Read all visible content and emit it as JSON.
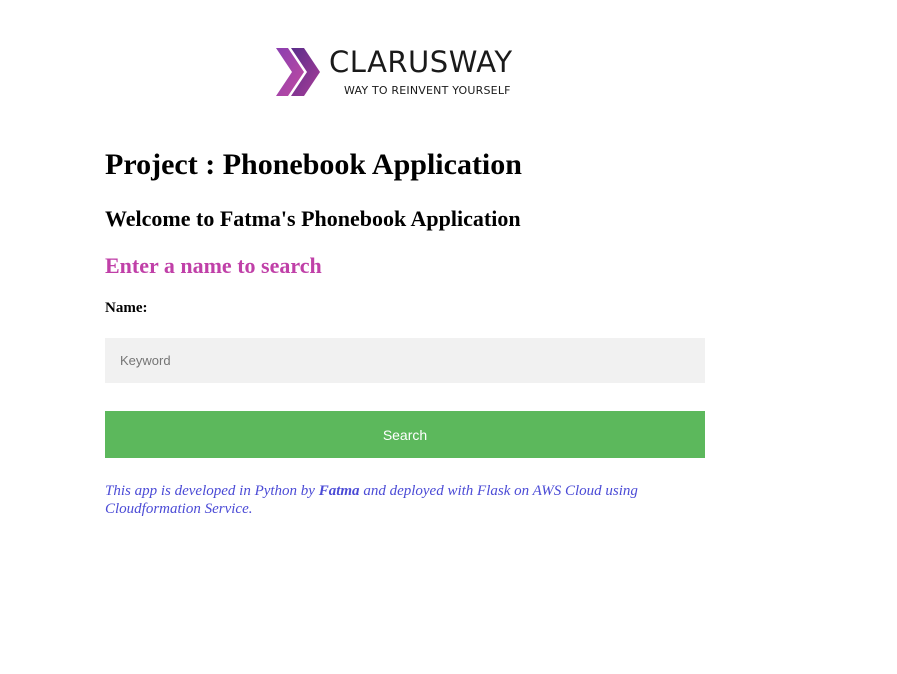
{
  "logo": {
    "wordmark": "CLARUSWAY",
    "tagline": "WAY TO REINVENT YOURSELF"
  },
  "header": {
    "title": "Project : Phonebook Application",
    "welcome": "Welcome to Fatma's Phonebook Application"
  },
  "search": {
    "heading": "Enter a name to search",
    "label": "Name:",
    "placeholder": "Keyword",
    "value": "",
    "button_label": "Search"
  },
  "footer": {
    "text_before": "This app is developed in Python by ",
    "author": "Fatma",
    "text_after": " and deployed with Flask on AWS Cloud using Cloudformation Service."
  },
  "colors": {
    "accent_heading": "#c040a8",
    "button": "#5cb85c",
    "footer_text": "#4b4bd6",
    "logo_purple": "#7a3aa6",
    "logo_pink": "#c14aa0"
  }
}
